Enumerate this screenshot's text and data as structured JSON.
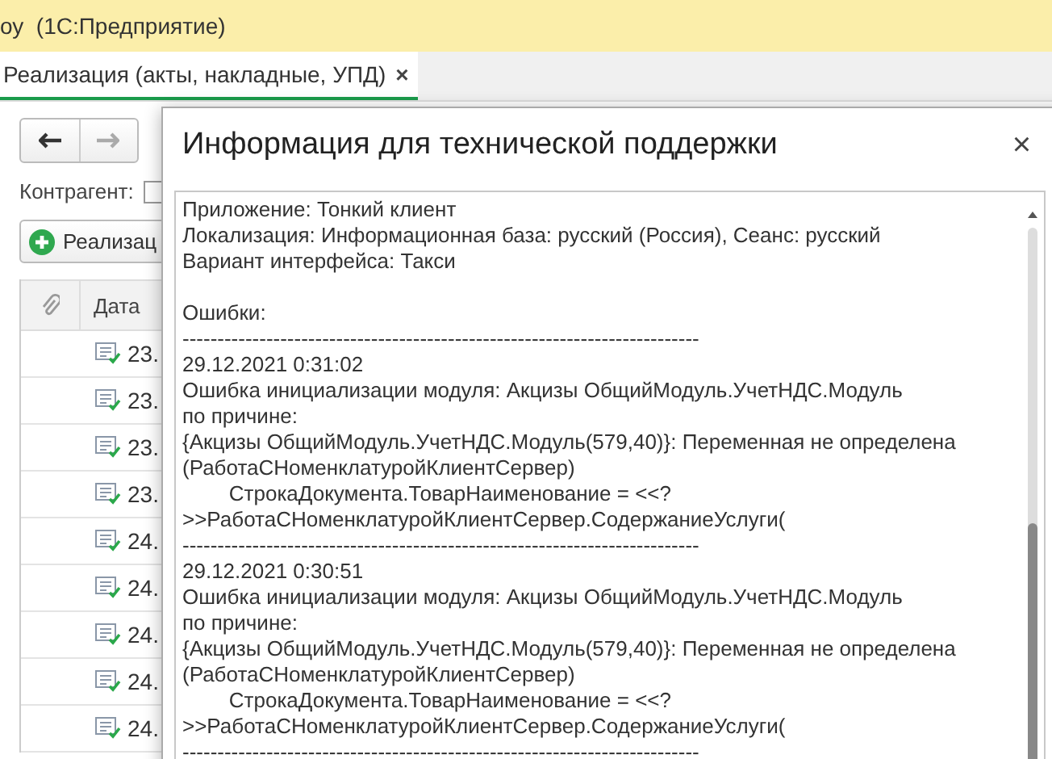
{
  "app_title": "оу  (1С:Предприятие)",
  "tabs": [
    {
      "label": "Реализация (акты, накладные, УПД)",
      "close": "×",
      "selected": true
    }
  ],
  "filter": {
    "label": "Контрагент:",
    "checked": false
  },
  "create_button": {
    "label": "Реализац"
  },
  "table": {
    "columns": [
      "Дата"
    ],
    "rows": [
      {
        "date": "23."
      },
      {
        "date": "23."
      },
      {
        "date": "23."
      },
      {
        "date": "23."
      },
      {
        "date": "24."
      },
      {
        "date": "24."
      },
      {
        "date": "24."
      },
      {
        "date": "24."
      },
      {
        "date": "24."
      }
    ]
  },
  "dialog": {
    "title": "Информация для технической поддержки",
    "close": "×",
    "text": "Приложение: Тонкий клиент\nЛокализация: Информационная база: русский (Россия), Сеанс: русский\nВариант интерфейса: Такси\n\nОшибки:\n--------------------------------------------------------------------------\n29.12.2021 0:31:02\nОшибка инициализации модуля: Акцизы ОбщийМодуль.УчетНДС.Модуль\nпо причине:\n{Акцизы ОбщийМодуль.УчетНДС.Модуль(579,40)}: Переменная не определена\n(РаботаСНоменклатуройКлиентСервер)\n\tСтрокаДокумента.ТоварНаименование = <<?\n>>РаботаСНоменклатуройКлиентСервер.СодержаниеУслуги(\n--------------------------------------------------------------------------\n29.12.2021 0:30:51\nОшибка инициализации модуля: Акцизы ОбщийМодуль.УчетНДС.Модуль\nпо причине:\n{Акцизы ОбщийМодуль.УчетНДС.Модуль(579,40)}: Переменная не определена\n(РаботаСНоменклатуройКлиентСервер)\n\tСтрокаДокумента.ТоварНаименование = <<?\n>>РаботаСНоменклатуройКлиентСервер.СодержаниеУслуги(\n--------------------------------------------------------------------------"
  }
}
